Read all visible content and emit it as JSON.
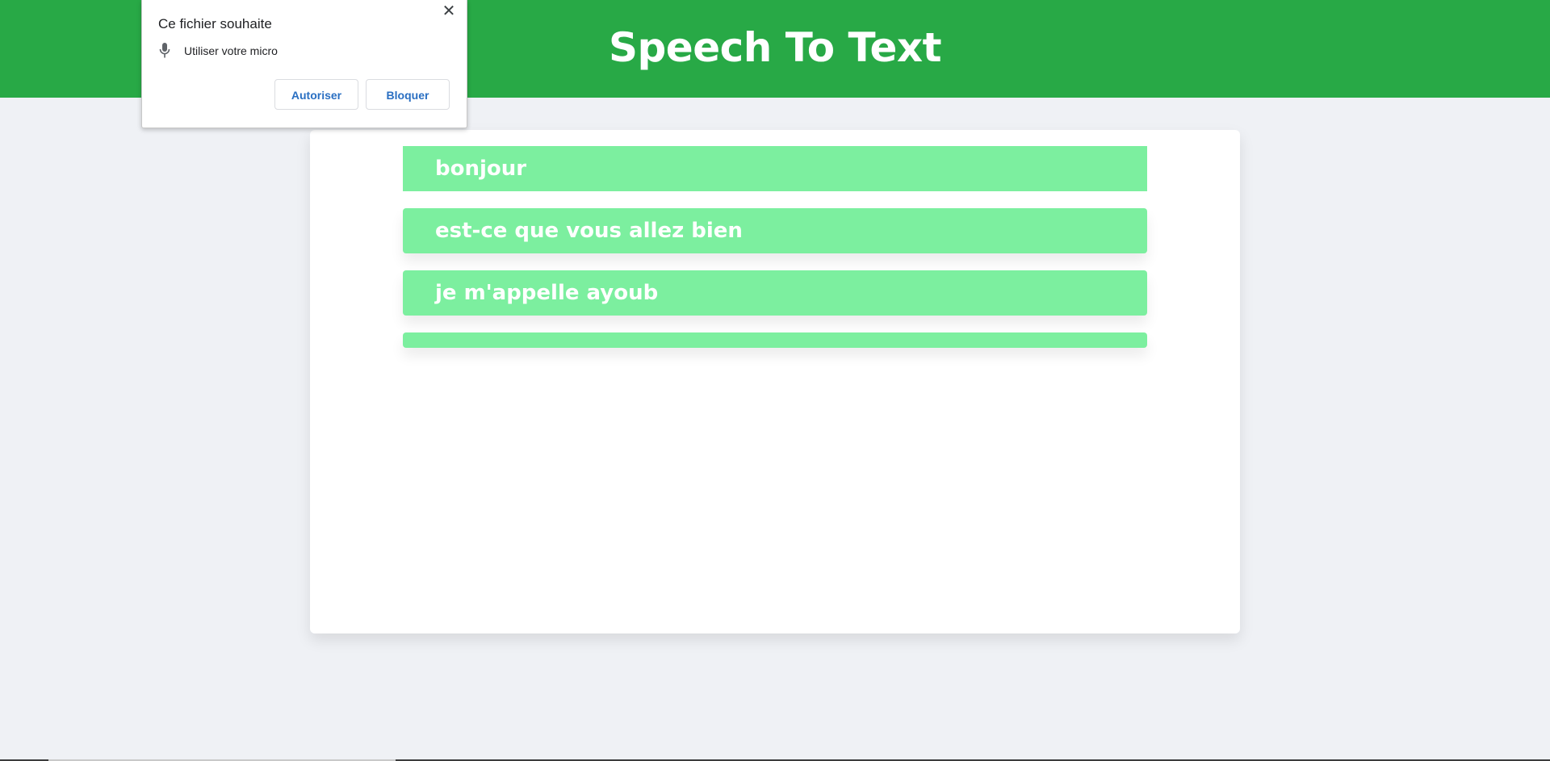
{
  "header": {
    "title": "Speech To Text"
  },
  "transcripts": [
    "bonjour",
    "est-ce que vous allez bien",
    "je m'appelle ayoub",
    ""
  ],
  "permission_popup": {
    "title": "Ce fichier souhaite",
    "permission_icon": "microphone-icon",
    "permission_label": "Utiliser votre micro",
    "close_icon": "close-icon",
    "allow_label": "Autoriser",
    "block_label": "Bloquer"
  },
  "colors": {
    "header_bg": "#28a946",
    "page_bg": "#eff1f5",
    "entry_bg": "#7cef9f",
    "button_text": "#2a6fc2"
  }
}
